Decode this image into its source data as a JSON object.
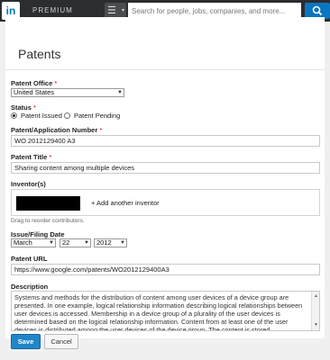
{
  "header": {
    "logo_text": "in",
    "premium_label": "PREMIUM",
    "menu_icon": "list-icon",
    "search_placeholder": "Search for people, jobs, companies, and more...",
    "search_icon": "search-icon",
    "brand_color": "#0a76c0"
  },
  "page": {
    "title": "Patents"
  },
  "form": {
    "office": {
      "label": "Patent Office",
      "required_mark": "*",
      "selected": "United States"
    },
    "status": {
      "label": "Status",
      "required_mark": "*",
      "options": [
        {
          "label": "Patent Issued",
          "selected": true
        },
        {
          "label": "Patent Pending",
          "selected": false
        }
      ]
    },
    "number": {
      "label": "Patent/Application Number",
      "required_mark": "*",
      "value": "WO 2012129400 A3"
    },
    "title": {
      "label": "Patent Title",
      "required_mark": "*",
      "value": "Sharing content among multiple devices"
    },
    "inventors": {
      "label": "Inventor(s)",
      "add_label": "+ Add another inventor",
      "hint": "Drag to reorder contributors."
    },
    "date": {
      "label": "Issue/Filing Date",
      "month": "March",
      "day": "22",
      "year": "2012"
    },
    "url": {
      "label": "Patent URL",
      "value": "https://www.google.com/patents/WO2012129400A3"
    },
    "description": {
      "label": "Description",
      "value": "Systems and methods for the distribution of content among user devices of a device group are presented. In one example, logical relationship information describing logical relationships between user devices is accessed. Membership in a device group of a plurality of the user devices is determined based on the logical relationship information. Content from at least one of the user devices is distributed among the user devices of the device group. The content is stored"
    },
    "buttons": {
      "save": "Save",
      "cancel": "Cancel"
    }
  }
}
